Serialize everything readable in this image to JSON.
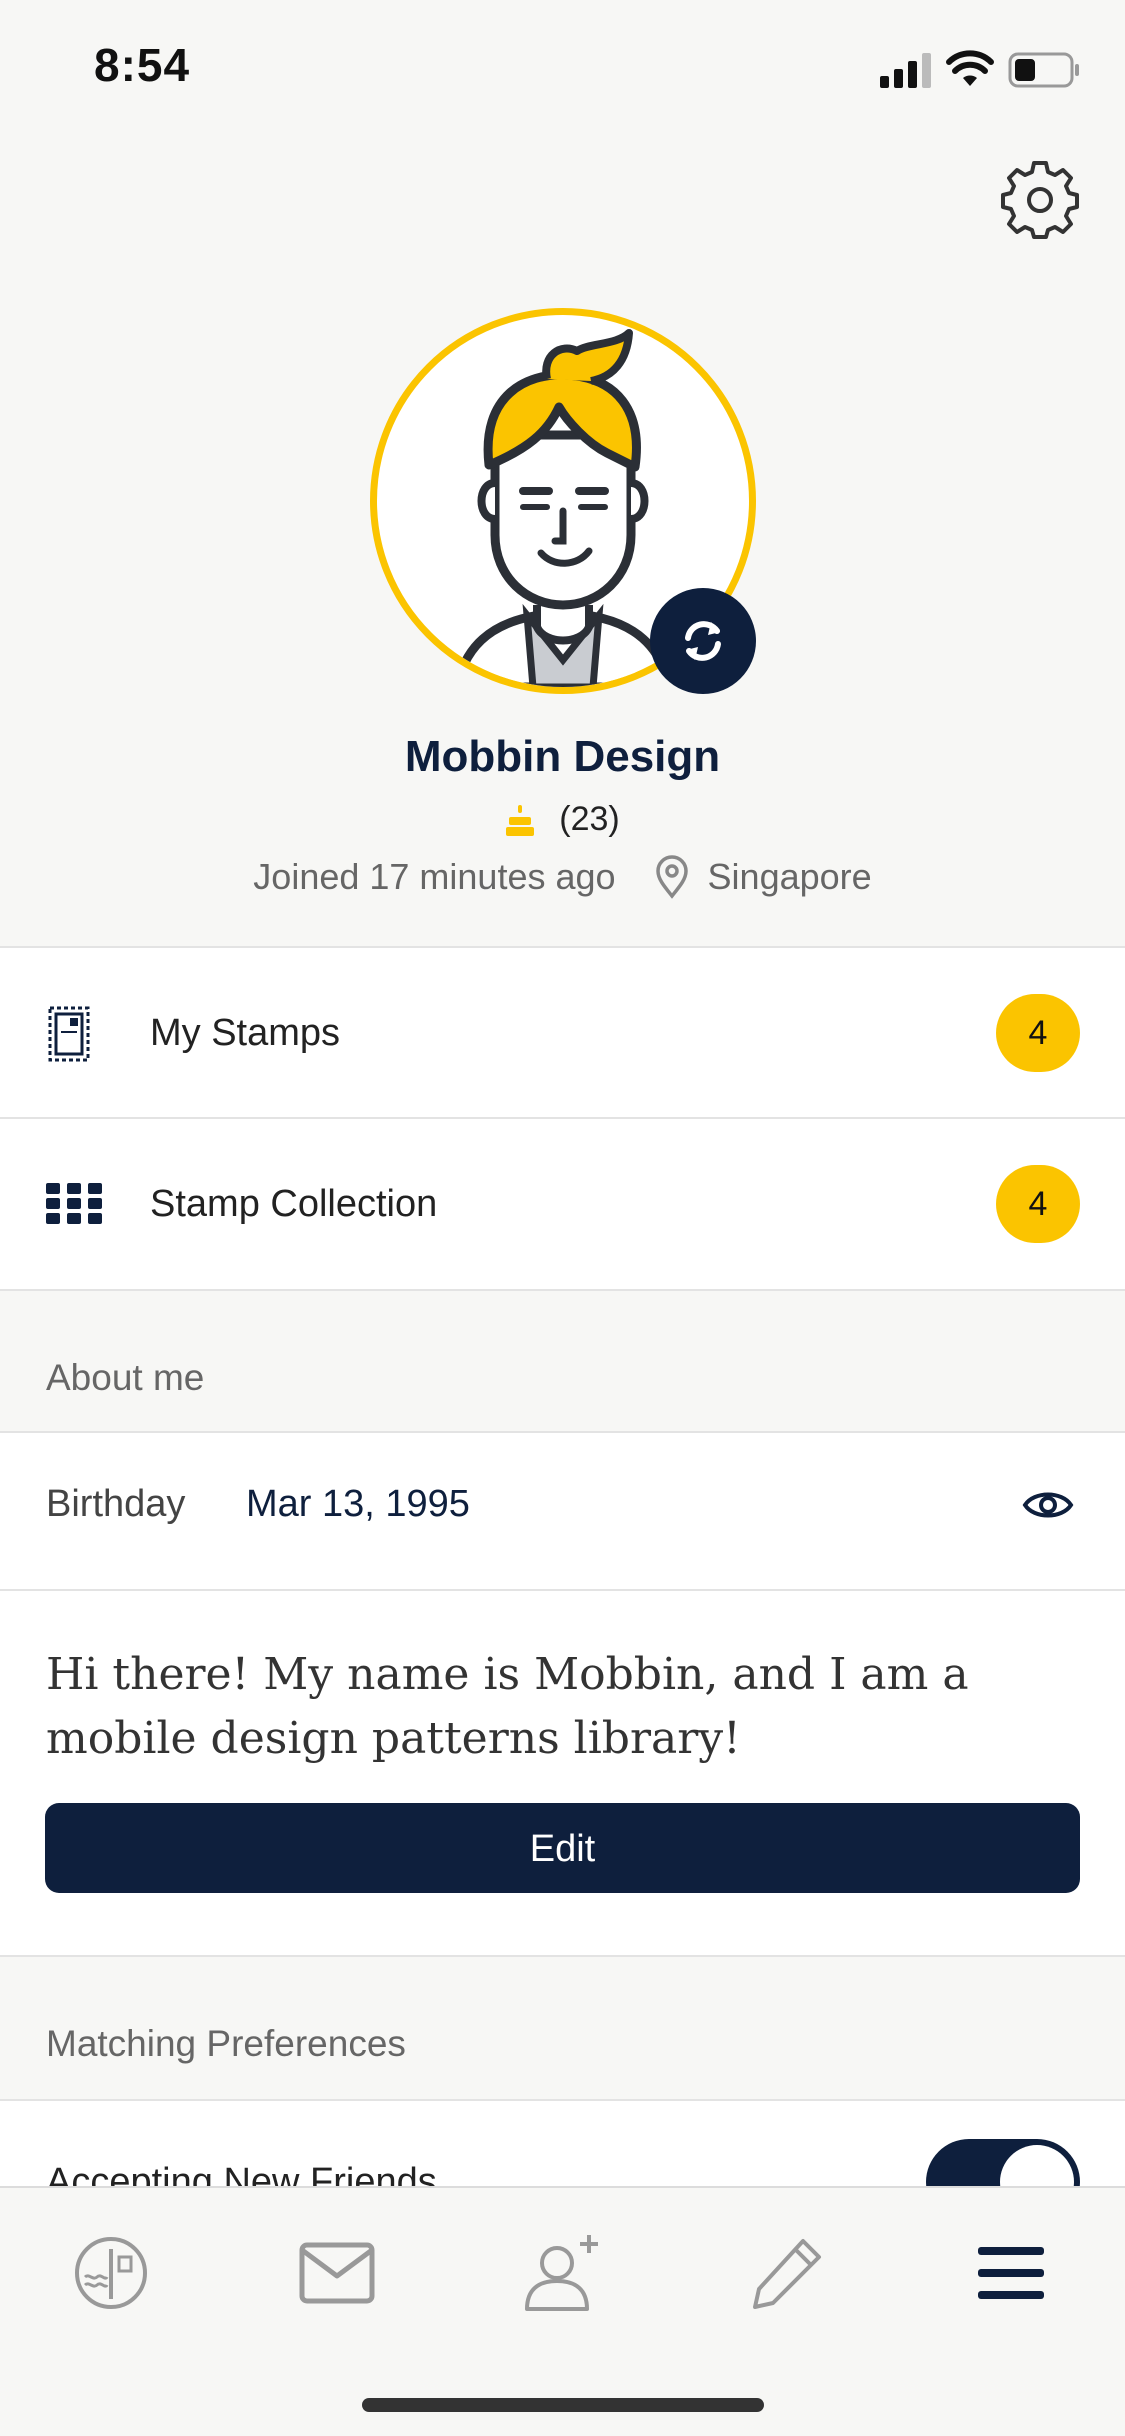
{
  "status_bar": {
    "time": "8:54"
  },
  "profile": {
    "name": "Mobbin Design",
    "age": "(23)",
    "joined": "Joined 17 minutes ago",
    "location": "Singapore"
  },
  "menu": {
    "my_stamps": {
      "label": "My Stamps",
      "count": "4"
    },
    "stamp_collection": {
      "label": "Stamp Collection",
      "count": "4"
    }
  },
  "about": {
    "header": "About me",
    "birthday_label": "Birthday",
    "birthday_value": "Mar 13, 1995",
    "bio": "Hi there! My name is Mobbin, and I am a mobile design patterns library!",
    "edit_label": "Edit"
  },
  "matching": {
    "header": "Matching Preferences",
    "accepting_new_friends_label": "Accepting New Friends",
    "accepting_new_friends_on": true
  },
  "colors": {
    "accent": "#fbc400",
    "navy": "#0e1f3d"
  },
  "tab_bar": {
    "items": [
      "stamp-letter-icon",
      "mail-icon",
      "add-friend-icon",
      "pencil-icon",
      "menu-icon"
    ],
    "active": "menu-icon"
  }
}
